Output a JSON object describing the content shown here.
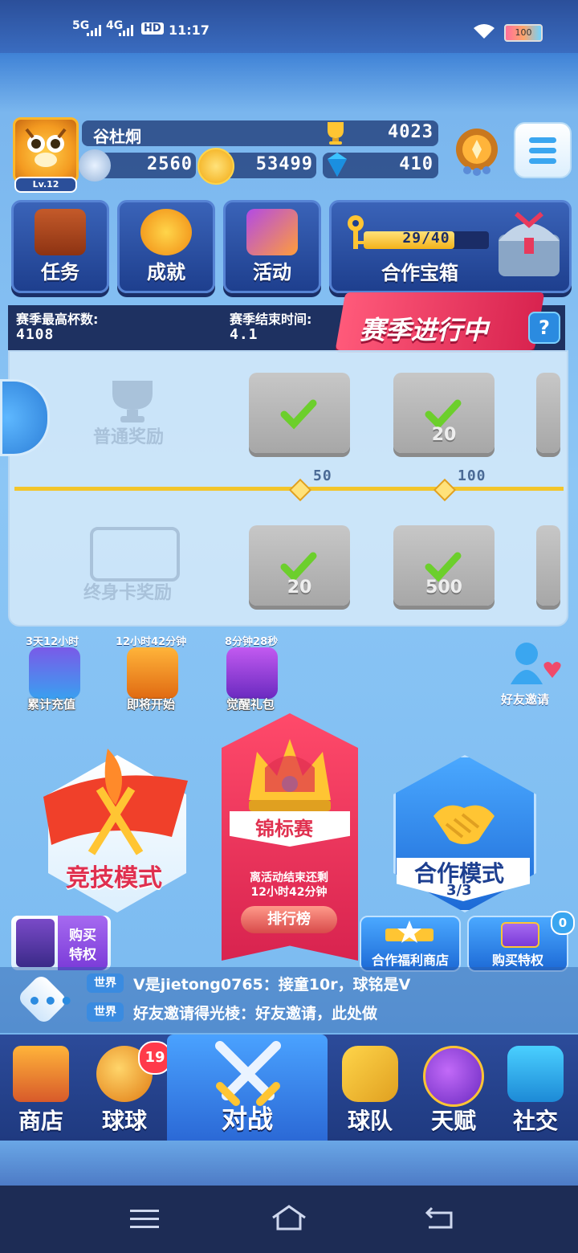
{
  "status": {
    "net1": "5G",
    "net2": "4G",
    "hd": "HD",
    "time": "11:17",
    "battery": "100"
  },
  "profile": {
    "name": "谷杜炯",
    "level": "Lv.12",
    "trophies": "4023",
    "star_points": "2560",
    "coins": "53499",
    "gems": "410"
  },
  "tiles": [
    {
      "label": "任务"
    },
    {
      "label": "成就"
    },
    {
      "label": "活动"
    }
  ],
  "coop_chest": {
    "progress_text": "29/40",
    "progress": 0.725,
    "label": "合作宝箱"
  },
  "season": {
    "max_cups_label": "赛季最高杯数:",
    "max_cups": "4108",
    "end_label": "赛季结束时间:",
    "end_value": "4.1",
    "banner": "赛季进行中",
    "help": "?"
  },
  "rewards": {
    "normal_label": "普通奖励",
    "lifetime_label": "终身卡奖励",
    "milestones": [
      "50",
      "100"
    ],
    "normal_counts": [
      "",
      "20"
    ],
    "lifetime_counts": [
      "20",
      "500"
    ]
  },
  "events": [
    {
      "time": "3天12小时",
      "label": "累计充值"
    },
    {
      "time": "12小时42分钟",
      "label": "即将开始"
    },
    {
      "time": "8分钟28秒",
      "label": "觉醒礼包"
    }
  ],
  "friend_invite": "好友邀请",
  "modes": {
    "competitive": "竞技模式",
    "tournament": {
      "title": "锦标赛",
      "desc_line1": "离活动结束还剩",
      "desc_line2": "12小时42分钟",
      "rank_btn": "排行榜"
    },
    "coop": {
      "title": "合作模式",
      "count": "3/3"
    }
  },
  "buy_privilege_left": "购买\n特权",
  "buy_privilege_left_l1": "购买",
  "buy_privilege_left_l2": "特权",
  "coop_shop": "合作福利商店",
  "buy_privilege": "购买特权",
  "badge_zero": "0",
  "chat": [
    {
      "tag": "世界",
      "msg": "V是jietong0765：接童10r，球铭是V"
    },
    {
      "tag": "世界",
      "msg": "好友邀请得光棱：好友邀请，此处做"
    }
  ],
  "nav": [
    {
      "label": "商店"
    },
    {
      "label": "球球",
      "badge": "19"
    },
    {
      "label": "对战"
    },
    {
      "label": "球队"
    },
    {
      "label": "天赋"
    },
    {
      "label": "社交"
    }
  ],
  "colors": {
    "accent": "#3aa6f0",
    "gold": "#ffc533",
    "danger": "#e0304f",
    "nav_active": "#3c8bf0"
  }
}
